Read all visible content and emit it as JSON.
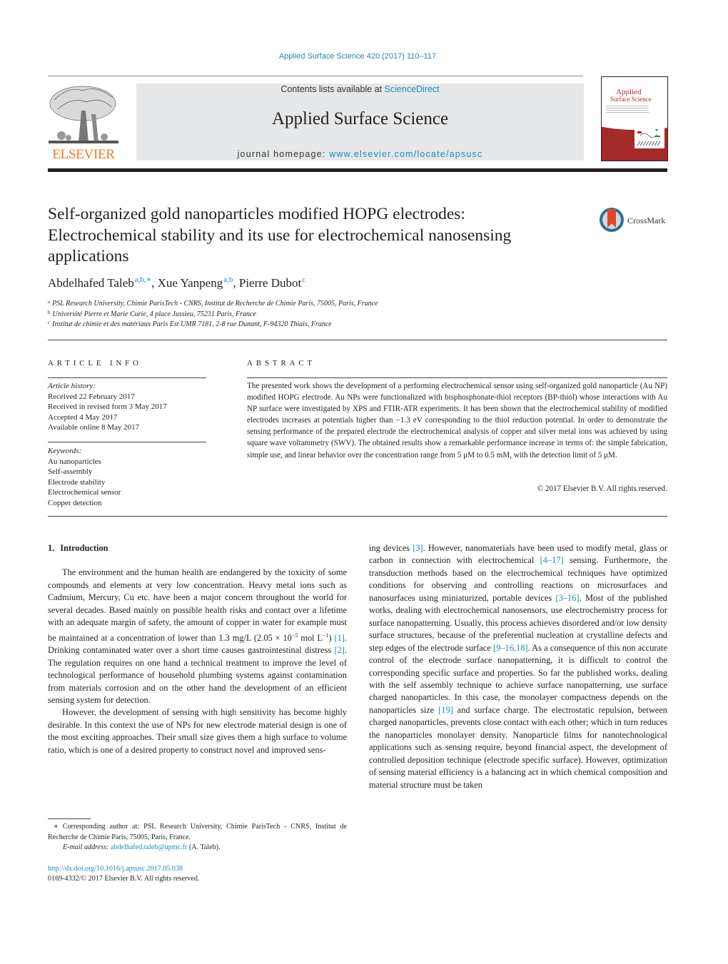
{
  "header": {
    "citation": "Applied Surface Science 420 (2017) 110–117",
    "contents_prefix": "Contents lists available at ",
    "contents_link": "ScienceDirect",
    "journal_title": "Applied Surface Science",
    "homepage_prefix": "journal homepage: ",
    "homepage_link": "www.elsevier.com/locate/apsusc",
    "publisher_logo_text": "ELSEVIER",
    "cover_title_line1": "Applied",
    "cover_title_line2": "Surface Science",
    "crossmark_label": "CrossMark"
  },
  "article": {
    "title_lines": [
      "Self-organized gold nanoparticles modified HOPG electrodes:",
      "Electrochemical stability and its use for electrochemical nanosensing",
      "applications"
    ],
    "authors": [
      {
        "name": "Abdelhafed Taleb",
        "sup": "a,b,∗"
      },
      {
        "name": "Xue Yanpeng",
        "sup": "a,b"
      },
      {
        "name": "Pierre Dubot",
        "sup": "c"
      }
    ],
    "affiliations": [
      {
        "mark": "a",
        "text": "PSL Research University, Chimie ParisTech - CNRS, Institut de Recherche de Chimie Paris, 75005, Paris, France"
      },
      {
        "mark": "b",
        "text": "Université Pierre et Marie Curie, 4 place Jussieu, 75231 Paris, France"
      },
      {
        "mark": "c",
        "text": "Institut de chimie et des matériaux Paris Est UMR 7181, 2-8 rue Dunant, F-94320 Thiais, France"
      }
    ]
  },
  "article_info": {
    "heading": "ARTICLE INFO",
    "history_label": "Article history:",
    "history": [
      "Received 22 February 2017",
      "Received in revised form 3 May 2017",
      "Accepted 4 May 2017",
      "Available online 8 May 2017"
    ],
    "keywords_label": "Keywords:",
    "keywords": [
      "Au nanoparticles",
      "Self-assembly",
      "Electrode stability",
      "Electrochemical sensor",
      "Copper detection"
    ]
  },
  "abstract": {
    "heading": "ABSTRACT",
    "text": "The presented work shows the development of a performing electrochemical sensor using self-organized gold nanoparticle (Au NP) modified HOPG electrode. Au NPs were functionalized with bisphosphonate-thiol receptors (BP-thiol) whose interactions with Au NP surface were investigated by XPS and FTIR-ATR experiments. It has been shown that the electrochemical stability of modified electrodes increases at potentials higher than −1.3 eV corresponding to the thiol reduction potential. In order to demonstrate the sensing performance of the prepared electrode the electrochemical analysis of copper and silver metal ions was achieved by using square wave voltammetry (SWV). The obtained results show a remarkable performance increase in terms of: the simple fabrication, simple use, and linear behavior over the concentration range from 5 μM to 0.5 mM, with the detection limit of 5 μM.",
    "copyright": "© 2017 Elsevier B.V. All rights reserved."
  },
  "body": {
    "section_number": "1.",
    "section_title": "Introduction",
    "p1": {
      "t1": "The environment and the human health are endangered by the toxicity of some compounds and elements at very low concentration. Heavy metal ions such as Cadmium, Mercury, Cu etc. have been a major concern throughout the world for several decades. Based mainly on possible health risks and contact over a lifetime with an adequate margin of safety, the amount of copper in water for example must be maintained at a concentration of lower than 1.3 mg/L (2.05 × 10",
      "exp1": "−5",
      "t2": " mol L",
      "exp2": "−1",
      "t3": ") ",
      "ref1": "[1]",
      "t4": ". Drinking contaminated water over a short time causes gastrointestinal distress ",
      "ref2": "[2]",
      "t5": ". The regulation requires on one hand a technical treatment to improve the level of technological performance of household plumbing systems against contamination from materials corrosion and on the other hand the development of an efficient sensing system for detection."
    },
    "p2": "However, the development of sensing with high sensitivity has become highly desirable. In this context the use of NPs for new electrode material design is one of the most exciting approaches. Their small size gives them a high surface to volume ratio, which is one of a desired property to construct novel and improved sens-",
    "right": {
      "t1": "ing devices ",
      "ref1": "[3]",
      "t2": ". However, nanomaterials have been used to modify metal, glass or carbon in connection with electrochemical ",
      "ref2": "[4–17]",
      "t3": " sensing. Furthermore, the transduction methods based on the electrochemical techniques have optimized conditions for observing and controlling reactions on microsurfaces and nanosurfaces using miniaturized, portable devices ",
      "ref3": "[3–16]",
      "t4": ". Most of the published works, dealing with electrochemical nanosensors, use electrochemistry process for surface nanopatterning. Usually, this process achieves disordered and/or low density surface structures, because of the preferential nucleation at crystalline defects and step edges of the electrode surface ",
      "ref4": "[9–16,18]",
      "t5": ". As a consequence of this non accurate control of the electrode surface nanopatterning, it is difficult to control the corresponding specific surface and properties. So far the published works, dealing with the self assembly technique to achieve surface nanopatterning, use surface charged nanoparticles. In this case, the monolayer compactness depends on the nanoparticles size ",
      "ref5": "[19]",
      "t6": " and surface charge. The electrostatic repulsion, between charged nanoparticles, prevents close contact with each other; which in turn reduces the nanoparticles monolayer density. Nanoparticle films for nanotechnological applications such as sensing require, beyond financial aspect, the development of controlled deposition technique (electrode specific surface). However, optimization of sensing material efficiency is a balancing act in which chemical composition and material structure must be taken"
    }
  },
  "footnote": {
    "star": "∗",
    "text": " Corresponding author at: PSL Research University, Chimie ParisTech - CNRS, Institut de Recherche de Chimie Paris, 75005, Paris, France.",
    "email_label": "E-mail address: ",
    "email": "abdelhafed.taleb@upmc.fr",
    "email_suffix": " (A. Taleb).",
    "doi": "http://dx.doi.org/10.1016/j.apsusc.2017.05.038",
    "issn": "0169-4332/© 2017 Elsevier B.V. All rights reserved."
  },
  "colors": {
    "link": "#1a8cb4",
    "publisher_orange": "#f07b1d",
    "masthead_gray": "#e6e7e8",
    "cover_red": "#a52a2a"
  }
}
